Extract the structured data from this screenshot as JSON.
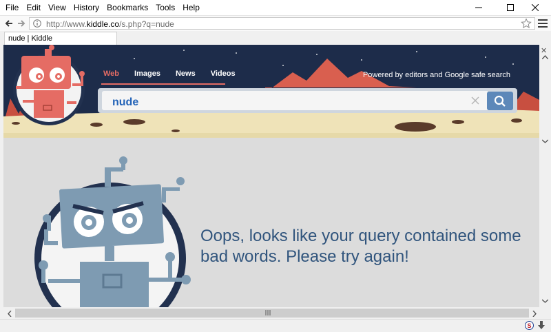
{
  "menubar": {
    "items": [
      "File",
      "Edit",
      "View",
      "History",
      "Bookmarks",
      "Tools",
      "Help"
    ]
  },
  "window_controls": {
    "minimize_icon": "minimize-icon",
    "maximize_icon": "maximize-icon",
    "close_icon": "close-icon"
  },
  "navbar": {
    "url_prefix": "http://www.",
    "url_domain": "kiddle.co",
    "url_suffix": "/s.php?q=nude"
  },
  "browser_tab": {
    "title": "nude | Kiddle"
  },
  "page": {
    "tabs": [
      "Web",
      "Images",
      "News",
      "Videos"
    ],
    "active_tab": "Web",
    "powered_by": "Powered by editors and Google safe search",
    "search": {
      "value": "nude"
    },
    "message": "Oops, looks like your query contained some bad words. Please try again!"
  },
  "colors": {
    "header_bg": "#1d2c4a",
    "active_tab": "#e56c64",
    "search_button": "#5d88b9",
    "message_text": "#31557d",
    "page_bg": "#dcdcdc"
  }
}
